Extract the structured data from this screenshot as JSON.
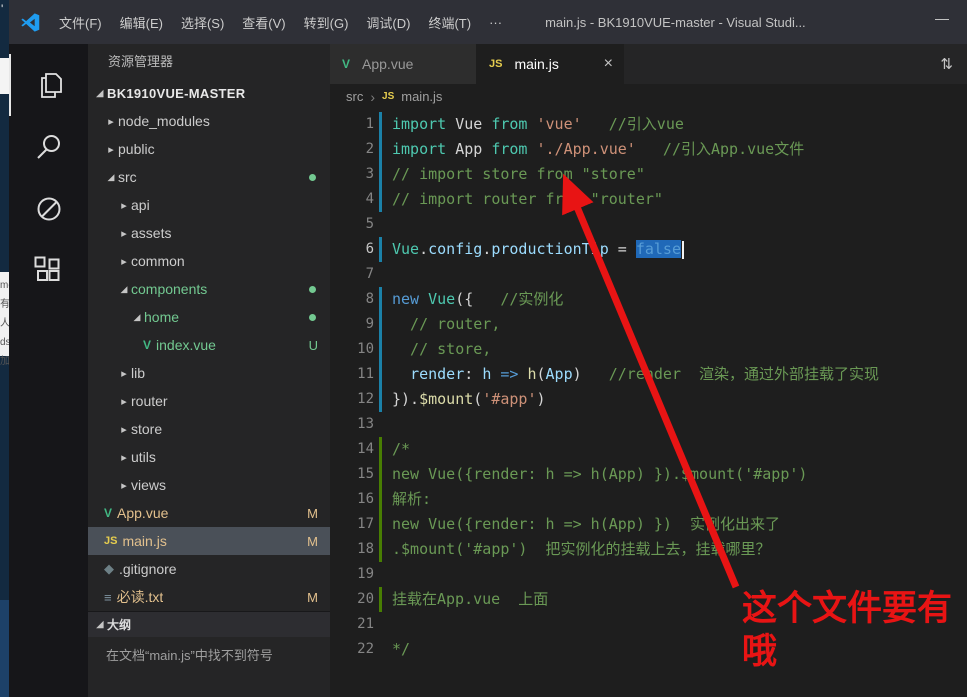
{
  "colors": {
    "annotation_red": "#e81414",
    "selection_blue": "#2069b8",
    "modified": "#e2c08d",
    "untracked": "#73c991",
    "gutter_modified": "#1b81a8",
    "gutter_added": "#487e02"
  },
  "window": {
    "title": "main.js - BK1910VUE-master - Visual Studi...",
    "menus": [
      "文件(F)",
      "编辑(E)",
      "选择(S)",
      "查看(V)",
      "转到(G)",
      "调试(D)",
      "终端(T)",
      "···"
    ],
    "minimize_glyph": "—"
  },
  "background_fragments": [
    "'",
    "me",
    "有人",
    "ds",
    "加"
  ],
  "activity_bar": {
    "icons": [
      "explorer-icon",
      "search-icon",
      "circle-slash-icon",
      "extensions-icon"
    ]
  },
  "sidebar": {
    "title": "资源管理器",
    "root": "BK1910VUE-MASTER",
    "items": [
      {
        "label": "node_modules",
        "indent": 1,
        "twistie": "collapsed"
      },
      {
        "label": "public",
        "indent": 1,
        "twistie": "collapsed"
      },
      {
        "label": "src",
        "indent": 1,
        "twistie": "expanded",
        "badge": "dot"
      },
      {
        "label": "api",
        "indent": 2,
        "twistie": "collapsed"
      },
      {
        "label": "assets",
        "indent": 2,
        "twistie": "collapsed"
      },
      {
        "label": "common",
        "indent": 2,
        "twistie": "collapsed"
      },
      {
        "label": "components",
        "indent": 2,
        "twistie": "expanded",
        "badge": "dot",
        "color": "untracked"
      },
      {
        "label": "home",
        "indent": 3,
        "twistie": "expanded",
        "badge": "dot",
        "color": "untracked"
      },
      {
        "label": "index.vue",
        "indent": 4,
        "icon": "vue",
        "badge": "U",
        "color": "untracked"
      },
      {
        "label": "lib",
        "indent": 2,
        "twistie": "collapsed"
      },
      {
        "label": "router",
        "indent": 2,
        "twistie": "collapsed"
      },
      {
        "label": "store",
        "indent": 2,
        "twistie": "collapsed"
      },
      {
        "label": "utils",
        "indent": 2,
        "twistie": "collapsed"
      },
      {
        "label": "views",
        "indent": 2,
        "twistie": "collapsed"
      },
      {
        "label": "App.vue",
        "indent": 1,
        "icon": "vue",
        "badge": "M",
        "color": "modified"
      },
      {
        "label": "main.js",
        "indent": 1,
        "icon": "js",
        "badge": "M",
        "color": "modified",
        "selected": true
      },
      {
        "label": ".gitignore",
        "indent": 1,
        "icon": "git"
      },
      {
        "label": "必读.txt",
        "indent": 1,
        "icon": "txt",
        "badge": "M",
        "color": "modified"
      }
    ],
    "outline": {
      "title": "大纲",
      "message": "在文档“main.js”中找不到符号"
    }
  },
  "tabs": [
    {
      "label": "App.vue",
      "icon": "vue",
      "active": false
    },
    {
      "label": "main.js",
      "icon": "js",
      "active": true,
      "close_glyph": "×"
    }
  ],
  "tab_actions": {
    "open_changes_glyph": "⇅"
  },
  "breadcrumb": {
    "separator": "›",
    "parts": [
      "src",
      "main.js"
    ]
  },
  "editor": {
    "token_colors": {
      "kw": "#4ec9b0",
      "kw2": "#569cd6",
      "type": "#4ec9b0",
      "mem": "#9cdcfe",
      "str": "#ce9178",
      "cmt": "#6a9955",
      "fn": "#dcdcaa",
      "pun": "#d4d4d4"
    },
    "lines": [
      {
        "n": 1,
        "ind": "mod",
        "segs": [
          [
            "import ",
            "kw"
          ],
          [
            "Vue ",
            "pun"
          ],
          [
            "from ",
            "kw"
          ],
          [
            "'vue'",
            "str"
          ],
          [
            "   //引入vue",
            "cmt"
          ]
        ]
      },
      {
        "n": 2,
        "ind": "mod",
        "segs": [
          [
            "import ",
            "kw"
          ],
          [
            "App ",
            "pun"
          ],
          [
            "from ",
            "kw"
          ],
          [
            "'./App.vue'",
            "str"
          ],
          [
            "   //引入App.vue文件",
            "cmt"
          ]
        ]
      },
      {
        "n": 3,
        "ind": "mod",
        "segs": [
          [
            "// import store from \"store\"",
            "cmt"
          ]
        ]
      },
      {
        "n": 4,
        "ind": "mod",
        "segs": [
          [
            "// import router from \"router\"",
            "cmt"
          ]
        ]
      },
      {
        "n": 5,
        "segs": []
      },
      {
        "n": 6,
        "ind": "mod",
        "cursor": true,
        "segs": [
          [
            "Vue",
            "type"
          ],
          [
            ".",
            "pun"
          ],
          [
            "config",
            "mem"
          ],
          [
            ".",
            "pun"
          ],
          [
            "productionTip",
            "mem"
          ],
          [
            " = ",
            "pun"
          ],
          [
            "false",
            "kw2",
            "sel"
          ]
        ]
      },
      {
        "n": 7,
        "segs": []
      },
      {
        "n": 8,
        "ind": "mod",
        "segs": [
          [
            "new ",
            "kw2"
          ],
          [
            "Vue",
            "type"
          ],
          [
            "({",
            "pun"
          ],
          [
            "   //实例化",
            "cmt"
          ]
        ]
      },
      {
        "n": 9,
        "ind": "mod",
        "segs": [
          [
            "  // router,",
            "cmt"
          ]
        ]
      },
      {
        "n": 10,
        "ind": "mod",
        "segs": [
          [
            "  // store,",
            "cmt"
          ]
        ]
      },
      {
        "n": 11,
        "ind": "mod",
        "segs": [
          [
            "  ",
            "pun"
          ],
          [
            "render",
            "mem"
          ],
          [
            ": ",
            "pun"
          ],
          [
            "h",
            "mem"
          ],
          [
            " => ",
            "kw2"
          ],
          [
            "h",
            "fn"
          ],
          [
            "(",
            "pun"
          ],
          [
            "App",
            "mem"
          ],
          [
            ")",
            "pun"
          ],
          [
            "   //render  渲染，通过外部挂载了实现",
            "cmt"
          ]
        ]
      },
      {
        "n": 12,
        "ind": "mod",
        "segs": [
          [
            "}).",
            "pun"
          ],
          [
            "$mount",
            "fn"
          ],
          [
            "(",
            "pun"
          ],
          [
            "'#app'",
            "str"
          ],
          [
            ")",
            "pun"
          ]
        ]
      },
      {
        "n": 13,
        "segs": []
      },
      {
        "n": 14,
        "ind": "add",
        "segs": [
          [
            "/*",
            "cmt"
          ]
        ]
      },
      {
        "n": 15,
        "ind": "add",
        "segs": [
          [
            "new Vue({render: h => h(App) }).$mount('#app')",
            "cmt"
          ]
        ]
      },
      {
        "n": 16,
        "ind": "add",
        "segs": [
          [
            "解析:",
            "cmt"
          ]
        ]
      },
      {
        "n": 17,
        "ind": "add",
        "segs": [
          [
            "new Vue({render: h => h(App) })  实例化出来了",
            "cmt"
          ]
        ]
      },
      {
        "n": 18,
        "ind": "add",
        "segs": [
          [
            ".$mount('#app')  把实例化的挂载上去，挂载哪里？",
            "cmt"
          ]
        ]
      },
      {
        "n": 19,
        "segs": []
      },
      {
        "n": 20,
        "ind": "add",
        "segs": [
          [
            "挂载在App.vue  上面",
            "cmt"
          ]
        ]
      },
      {
        "n": 21,
        "segs": []
      },
      {
        "n": 22,
        "segs": [
          [
            "*/",
            "cmt"
          ]
        ]
      }
    ]
  },
  "annotation": {
    "lines": [
      "这个文件要有",
      "哦"
    ]
  }
}
